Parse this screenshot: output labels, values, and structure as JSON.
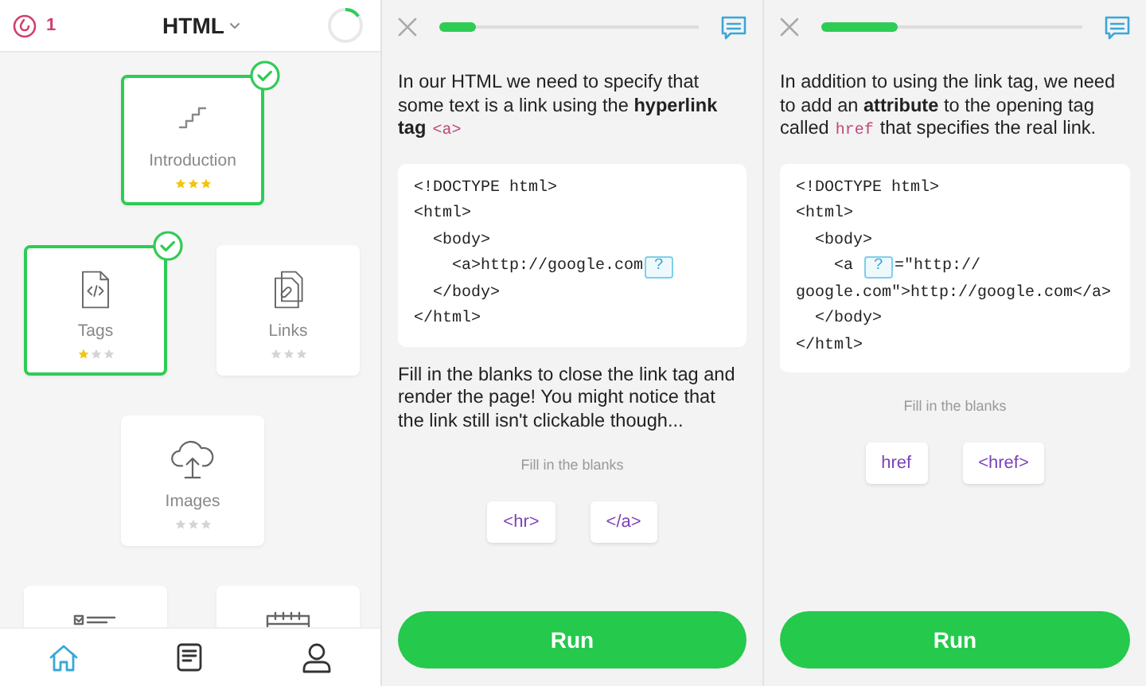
{
  "home": {
    "header": {
      "streak": "1",
      "title": "HTML",
      "progress": {
        "level": 0.15
      }
    },
    "rows": [
      [
        {
          "kind": "stairs",
          "title": "Introduction",
          "completed": true,
          "stars": 3
        }
      ],
      [
        {
          "kind": "code-file",
          "title": "Tags",
          "completed": true,
          "stars": 1
        },
        {
          "kind": "linked-files",
          "title": "Links",
          "completed": false,
          "stars": 0
        }
      ],
      [
        {
          "kind": "cloud-upload",
          "title": "Images",
          "completed": false,
          "stars": 0
        }
      ],
      [
        {
          "kind": "checklist"
        },
        {
          "kind": "calendar"
        }
      ]
    ],
    "nav": [
      {
        "kind": "home",
        "selected": true
      },
      {
        "kind": "book",
        "selected": false
      },
      {
        "kind": "profile",
        "selected": false
      }
    ]
  },
  "lessons": [
    {
      "progress": {
        "level": 0.14
      },
      "intro": [
        {
          "kind": "text",
          "text": "In our HTML we need to specify that some text is a link using the **hyperlink tag**"
        },
        {
          "kind": "code",
          "text": "<a>"
        }
      ],
      "code": [
        [
          {
            "kind": "text",
            "text": "<!DOCTYPE html>"
          }
        ],
        [
          {
            "kind": "text",
            "text": "<html>"
          }
        ],
        [
          {
            "kind": "text",
            "text": "  <body>"
          }
        ],
        [
          {
            "kind": "text",
            "text": "    <a>http://google.com"
          },
          {
            "kind": "blank",
            "text": "?"
          }
        ],
        [
          {
            "kind": "text",
            "text": "  </body>"
          }
        ],
        [
          {
            "kind": "text",
            "text": "</html>"
          }
        ]
      ],
      "instruction": "Fill in the blanks to close the link tag and render the page! You might notice that the link still isn't clickable though...",
      "hint": "Fill in the blanks",
      "options": [
        "<hr>",
        "</a>"
      ],
      "button": "Run"
    },
    {
      "progress": {
        "level": 0.29
      },
      "intro": [
        {
          "kind": "text",
          "text": "In addition to using the link tag, we need to add an **attribute** to the opening tag called"
        },
        {
          "kind": "code",
          "text": "href"
        },
        {
          "kind": "text",
          "text": "that specifies the real link."
        }
      ],
      "code": [
        [
          {
            "kind": "text",
            "text": "<!DOCTYPE html>"
          }
        ],
        [
          {
            "kind": "text",
            "text": "<html>"
          }
        ],
        [
          {
            "kind": "text",
            "text": "  <body>"
          }
        ],
        [
          {
            "kind": "text",
            "text": "    <a "
          },
          {
            "kind": "blank",
            "text": "?"
          },
          {
            "kind": "text",
            "text": "=\"http://"
          }
        ],
        [
          {
            "kind": "text",
            "text": "google.com\">http://google.com</a>"
          }
        ],
        [
          {
            "kind": "text",
            "text": "  </body>"
          }
        ],
        [
          {
            "kind": "text",
            "text": "</html>"
          }
        ]
      ],
      "hint": "Fill in the blanks",
      "options": [
        "href",
        "<href>"
      ],
      "button": "Run"
    }
  ]
}
